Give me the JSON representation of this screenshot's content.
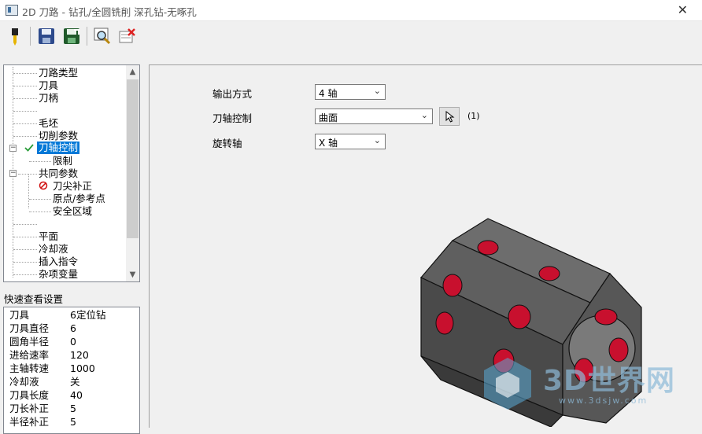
{
  "window": {
    "title": "2D 刀路 - 钻孔/全圆铣削 深孔钻-无啄孔",
    "close_glyph": "✕"
  },
  "toolbar": {
    "buttons": [
      {
        "name": "tool-button",
        "icon": "drill-tool-icon"
      },
      {
        "name": "save-button",
        "icon": "save-icon"
      },
      {
        "name": "save-as-button",
        "icon": "save-as-icon"
      },
      {
        "name": "preview-button",
        "icon": "preview-magnify-icon"
      },
      {
        "name": "delete-button",
        "icon": "delete-icon"
      }
    ]
  },
  "tree": {
    "items": [
      {
        "label": "刀路类型",
        "level": 0
      },
      {
        "label": "刀具",
        "level": 0
      },
      {
        "label": "刀柄",
        "level": 0
      },
      {
        "label": "",
        "level": 0
      },
      {
        "label": "毛坯",
        "level": 0
      },
      {
        "label": "切削参数",
        "level": 0
      },
      {
        "label": "刀轴控制",
        "level": 0,
        "selected": true,
        "status": "check"
      },
      {
        "label": "限制",
        "level": 1
      },
      {
        "label": "共同参数",
        "level": 0
      },
      {
        "label": "刀尖补正",
        "level": 1,
        "status": "disabled"
      },
      {
        "label": "原点/参考点",
        "level": 1
      },
      {
        "label": "安全区域",
        "level": 1
      },
      {
        "label": "",
        "level": 0
      },
      {
        "label": "平面",
        "level": 0
      },
      {
        "label": "冷却液",
        "level": 0
      },
      {
        "label": "插入指令",
        "level": 0
      },
      {
        "label": "杂项变量",
        "level": 0
      }
    ]
  },
  "quick": {
    "title": "快速查看设置",
    "rows": [
      {
        "key": "刀具",
        "value": "6定位钻"
      },
      {
        "key": "刀具直径",
        "value": "6"
      },
      {
        "key": "圆角半径",
        "value": "0"
      },
      {
        "key": "进给速率",
        "value": "120"
      },
      {
        "key": "主轴转速",
        "value": "1000"
      },
      {
        "key": "冷却液",
        "value": "关"
      },
      {
        "key": "刀具长度",
        "value": "40"
      },
      {
        "key": "刀长补正",
        "value": "5"
      },
      {
        "key": "半径补正",
        "value": "5"
      }
    ]
  },
  "form": {
    "output_label": "输出方式",
    "output_value": "4 轴",
    "axis_label": "刀轴控制",
    "axis_value": "曲面",
    "pick_count": "(1)",
    "rotary_label": "旋转轴",
    "rotary_value": "X 轴"
  },
  "watermark": {
    "brand": "3D世界网",
    "url": "www.3dsjw.com"
  },
  "colors": {
    "selection": "#0078d7",
    "hole_red": "#c8102e",
    "part_gray": "#5c5c5c"
  }
}
